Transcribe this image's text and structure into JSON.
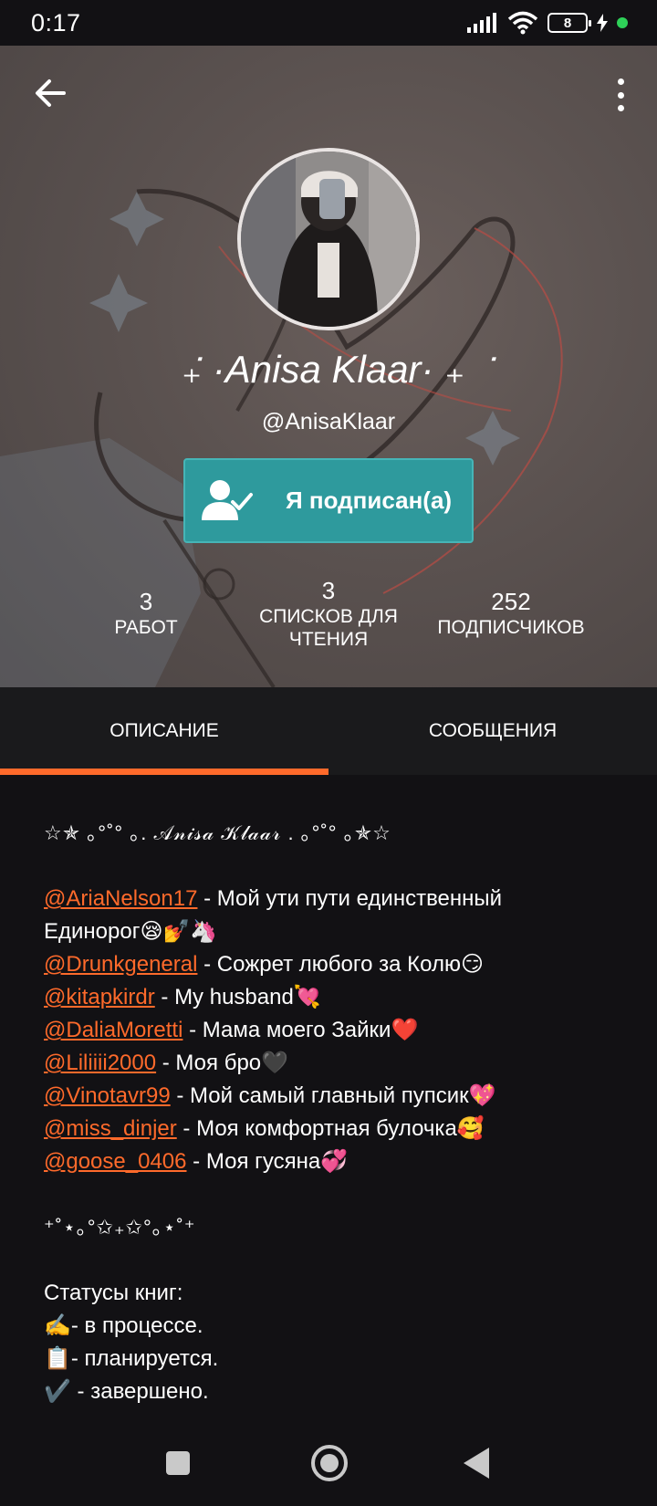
{
  "status_bar": {
    "time": "0:17",
    "battery": "8"
  },
  "profile": {
    "display_name": "݁₊ ·Anisa Klaar· ₊ ݁",
    "username": "@AnisaKlaar",
    "follow_button": "Я подписан(а)",
    "stats": [
      {
        "value": "3",
        "label": "РАБОТ"
      },
      {
        "value": "3",
        "label": "СПИСКОВ ДЛЯ ЧТЕНИЯ"
      },
      {
        "value": "252",
        "label": "ПОДПИСЧИКОВ"
      }
    ]
  },
  "tabs": [
    {
      "label": "ОПИСАНИЕ",
      "active": true
    },
    {
      "label": "СООБЩЕНИЯ",
      "active": false
    }
  ],
  "description": {
    "header_deco": "☆✯ ｡°˚° ｡. 𝒜𝓃𝒾𝓈𝒶 𝒦𝓁𝒶𝒶𝓇 . ｡°˚° ｡✯☆",
    "mentions": [
      {
        "handle": "@AriaNelson17",
        "text": " - Мой ути пути единственный",
        "text2": "Единорог😪💅🦄"
      },
      {
        "handle": "@Drunkgeneral",
        "text": " - Сожрет любого за Колю😏"
      },
      {
        "handle": "@kitapkirdr",
        "text": " - My husband💘"
      },
      {
        "handle": "@DaliaMoretti",
        "text": " - Мама моего Зайки❤️"
      },
      {
        "handle": "@Liliiii2000",
        "text": " - Моя бро🖤"
      },
      {
        "handle": "@Vinotavr99",
        "text": " - Мой самый главный пупсик💖"
      },
      {
        "handle": "@miss_dinjer",
        "text": " - Моя комфортная булочка🥰"
      },
      {
        "handle": "@goose_0406",
        "text": " - Моя гусяна💞"
      }
    ],
    "divider_deco": "⁺˚⋆｡°✩₊✩°｡⋆˚⁺",
    "status_title": "Статусы книг:",
    "statuses": [
      "✍️- в процессе.",
      "📋- планируется.",
      "✔️ - завершено."
    ]
  },
  "colors": {
    "accent": "#ff6a2b",
    "follow": "#2e9a9d",
    "background": "#121114"
  },
  "icons": {
    "back": "back-arrow-icon",
    "menu": "more-vertical-icon",
    "follow": "user-check-icon"
  }
}
